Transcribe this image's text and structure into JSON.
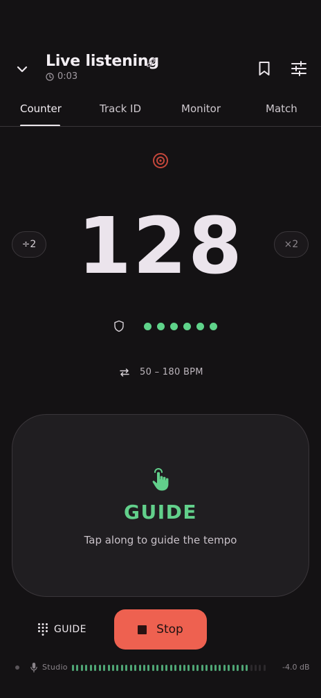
{
  "header": {
    "title": "Live listening",
    "duration": "0:03"
  },
  "tabs": [
    {
      "label": "Counter",
      "active": true
    },
    {
      "label": "Track ID",
      "active": false
    },
    {
      "label": "Monitor",
      "active": false
    },
    {
      "label": "Match",
      "active": false
    }
  ],
  "counter": {
    "bpm": "128",
    "half_label": "÷2",
    "double_label": "×2",
    "confidence_level": 6,
    "confidence_max": 6,
    "range": "50 – 180 BPM"
  },
  "guide_pad": {
    "label": "GUIDE",
    "hint": "Tap along to guide the tempo"
  },
  "controls": {
    "guide_toggle_label": "GUIDE",
    "stop_label": "Stop"
  },
  "input": {
    "name": "Studio",
    "level_db": "-4.0 dB",
    "meter_fraction": 0.9
  },
  "colors": {
    "background": "#141214",
    "accent_green": "#62d08b",
    "stop_red": "#ee6150",
    "target_red": "#c4473b"
  },
  "icons": {
    "back": "chevron-down-icon",
    "edit": "pencil-icon",
    "clock": "clock-icon",
    "bookmark": "bookmark-icon",
    "settings": "sliders-icon",
    "target": "target-icon",
    "confidence": "shield-icon",
    "range": "swap-arrows-icon",
    "guide": "tap-hand-icon",
    "keypad": "keypad-icon",
    "stop": "stop-square-icon",
    "mic": "microphone-icon"
  }
}
